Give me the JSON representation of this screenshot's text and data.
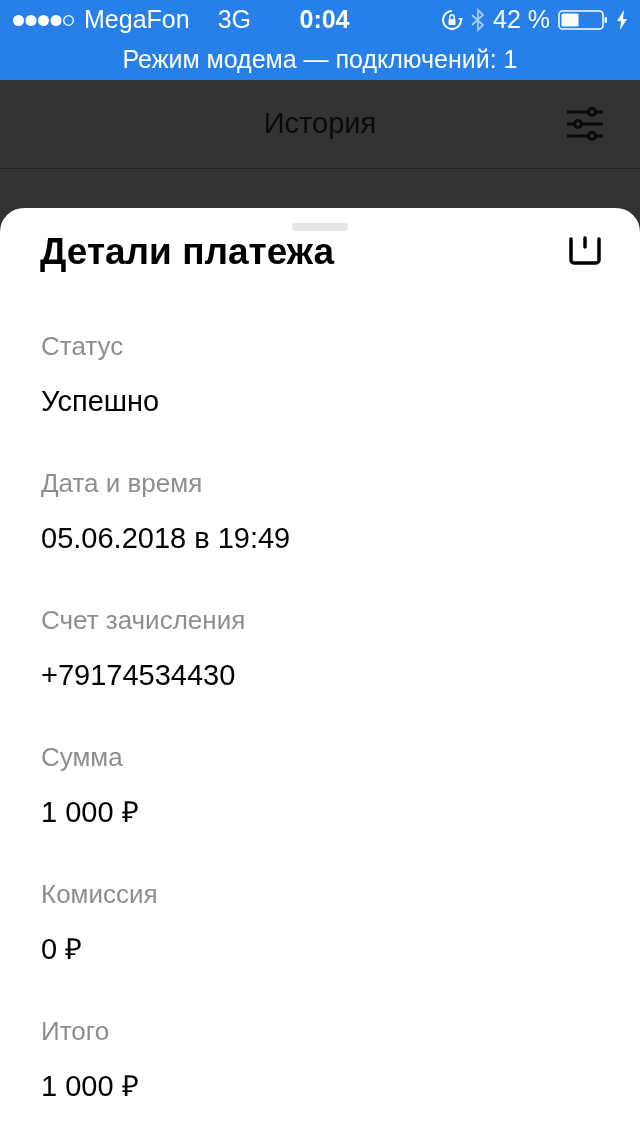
{
  "status_bar": {
    "carrier": "MegaFon",
    "network": "3G",
    "time": "0:04",
    "battery": "42 %"
  },
  "hotspot_banner": "Режим модема — подключений: 1",
  "header": {
    "title": "История"
  },
  "sheet": {
    "title": "Детали платежа",
    "fields": [
      {
        "label": "Статус",
        "value": "Успешно"
      },
      {
        "label": "Дата и время",
        "value": "05.06.2018 в 19:49"
      },
      {
        "label": "Счет зачисления",
        "value": "+79174534430"
      },
      {
        "label": "Сумма",
        "value": "1 000 ₽"
      },
      {
        "label": "Комиссия",
        "value": "0 ₽"
      },
      {
        "label": "Итого",
        "value": "1 000 ₽"
      }
    ]
  }
}
